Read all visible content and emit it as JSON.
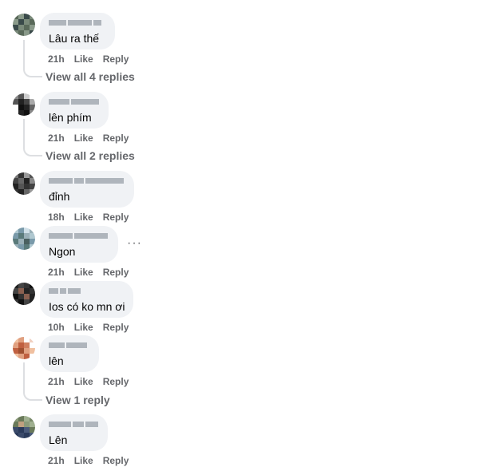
{
  "comments": [
    {
      "text": "Lâu ra thế",
      "time": "21h",
      "like": "Like",
      "reply": "Reply",
      "view_replies": "View all 4 replies",
      "avatar_colors": [
        "#5a6a5a",
        "#8a9a8a",
        "#3a4a4a",
        "#7a8a7a"
      ]
    },
    {
      "text": "lên phím",
      "time": "21h",
      "like": "Like",
      "reply": "Reply",
      "view_replies": "View all 2 replies",
      "avatar_colors": [
        "#222222",
        "#555555",
        "#111111",
        "#888888"
      ]
    },
    {
      "text": "đỉnh",
      "time": "18h",
      "like": "Like",
      "reply": "Reply",
      "view_replies": "",
      "avatar_colors": [
        "#333333",
        "#666666",
        "#444444",
        "#222222"
      ]
    },
    {
      "text": "Ngon",
      "time": "21h",
      "like": "Like",
      "reply": "Reply",
      "view_replies": "",
      "more": "···",
      "avatar_colors": [
        "#7a9aaa",
        "#b0c8d0",
        "#5a7a7a",
        "#9ab0b8"
      ]
    },
    {
      "text": "Ios có ko mn ơi",
      "time": "10h",
      "like": "Like",
      "reply": "Reply",
      "view_replies": "",
      "avatar_colors": [
        "#222222",
        "#444444",
        "#111111",
        "#8a6050"
      ]
    },
    {
      "text": "lên",
      "time": "21h",
      "like": "Like",
      "reply": "Reply",
      "view_replies": "View 1 reply",
      "avatar_colors": [
        "#e0a080",
        "#c06040",
        "#f0c0a0",
        "#a05030"
      ]
    },
    {
      "text": "Lên",
      "time": "21h",
      "like": "Like",
      "reply": "Reply",
      "view_replies": "",
      "avatar_colors": [
        "#6a7a5a",
        "#3a4a6a",
        "#8a9a7a",
        "#2a3a5a"
      ]
    }
  ]
}
